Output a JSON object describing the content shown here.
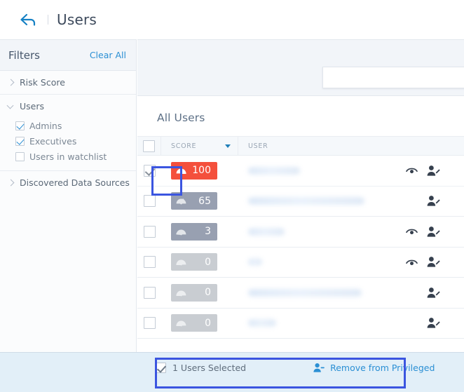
{
  "header": {
    "back_icon": "back-arrow-icon",
    "title": "Users"
  },
  "sidebar": {
    "title": "Filters",
    "clear_all": "Clear All",
    "groups": [
      {
        "label": "Risk Score",
        "expanded": false,
        "options": []
      },
      {
        "label": "Users",
        "expanded": true,
        "options": [
          {
            "label": "Admins",
            "checked": true
          },
          {
            "label": "Executives",
            "checked": true
          },
          {
            "label": "Users in watchlist",
            "checked": false
          }
        ]
      },
      {
        "label": "Discovered Data Sources",
        "expanded": false,
        "options": []
      }
    ]
  },
  "search": {
    "value": "",
    "placeholder": ""
  },
  "main": {
    "section_title": "All Users",
    "columns": [
      {
        "key": "select",
        "label": ""
      },
      {
        "key": "score",
        "label": "SCORE",
        "sorted": true,
        "sort_dir": "desc"
      },
      {
        "key": "user",
        "label": "USER"
      }
    ],
    "rows": [
      {
        "selected": true,
        "score": 100,
        "score_style": "red",
        "user": "",
        "user_redacted": true,
        "user_width": 74,
        "watchlist_icon": true,
        "edit_icon": true
      },
      {
        "selected": false,
        "score": 65,
        "score_style": "gray",
        "user": "",
        "user_redacted": true,
        "user_width": 166,
        "watchlist_icon": false,
        "edit_icon": true
      },
      {
        "selected": false,
        "score": 3,
        "score_style": "gray",
        "user": "",
        "user_redacted": true,
        "user_width": 52,
        "watchlist_icon": true,
        "edit_icon": true
      },
      {
        "selected": false,
        "score": 0,
        "score_style": "lgray",
        "user": "",
        "user_redacted": true,
        "user_width": 20,
        "watchlist_icon": true,
        "edit_icon": true
      },
      {
        "selected": false,
        "score": 0,
        "score_style": "lgray",
        "user": "",
        "user_redacted": true,
        "user_width": 162,
        "watchlist_icon": false,
        "edit_icon": true
      },
      {
        "selected": false,
        "score": 0,
        "score_style": "lgray",
        "user": "",
        "user_redacted": true,
        "user_width": 40,
        "watchlist_icon": false,
        "edit_icon": true
      }
    ]
  },
  "selection_bar": {
    "count_label": "1 Users Selected",
    "action_label": "Remove from Privileged",
    "action_icon": "user-remove-icon"
  },
  "colors": {
    "accent_link": "#2a8fd4",
    "score_high": "#f4503c",
    "score_mid": "#98a0b1",
    "score_zero": "#c9cdd2",
    "highlight_box": "#3b55e0",
    "selection_bar_bg": "#e2eff8",
    "header_band_bg": "#f2f5f9"
  },
  "icons": {
    "back": "back-arrow-icon",
    "chevron_right": "chevron-right-icon",
    "chevron_down": "chevron-down-icon",
    "sort_caret": "caret-down-icon",
    "gauge": "gauge-icon",
    "eye": "eye-watchlist-icon",
    "user_edit": "user-edit-icon"
  }
}
